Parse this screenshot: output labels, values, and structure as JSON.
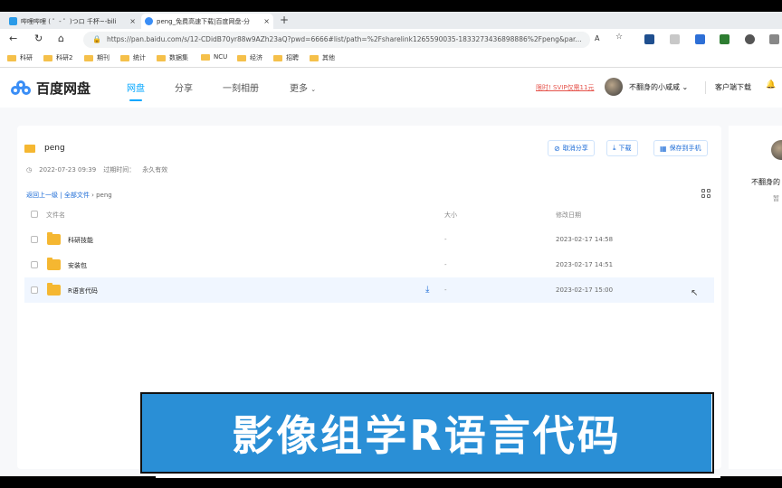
{
  "browser": {
    "tabs": [
      {
        "title": "哔哩哔哩 ( ゜- ゜)つロ 千杯~-bili",
        "color": "#2b9be8"
      },
      {
        "title": "peng_免费高速下载|百度网盘-分",
        "color": "#3a8ef6"
      }
    ],
    "new_tab": "+",
    "close": "×",
    "url": "https://pan.baidu.com/s/12-CDidB70yr88w9AZh23aQ?pwd=6666#list/path=%2Fsharelink1265590035-1833273436898886%2Fpeng&par...",
    "zoom_indicator": "A"
  },
  "bookmarks": [
    "科研",
    "科研2",
    "期刊",
    "统计",
    "数据集",
    "NCU",
    "经济",
    "招聘",
    "其他"
  ],
  "site": {
    "logo": "百度网盘",
    "nav": [
      "网盘",
      "分享",
      "一刻相册",
      "更多"
    ],
    "promo": "限时! SVIP仅需11元",
    "username": "不翻身的小咸咸",
    "client_download": "客户端下载"
  },
  "share": {
    "title": "peng",
    "created": "2022-07-23 09:39",
    "expire_label": "过期时间：",
    "expire_value": "永久有效",
    "buttons": {
      "cancel_share": "取消分享",
      "download": "下载",
      "save_phone": "保存到手机"
    },
    "breadcrumb": {
      "back": "返回上一级",
      "all": "全部文件",
      "current": "peng"
    },
    "columns": {
      "name": "文件名",
      "size": "大小",
      "date": "修改日期"
    },
    "files": [
      {
        "name": "科研技能",
        "size": "-",
        "date": "2023-02-17 14:58"
      },
      {
        "name": "安装包",
        "size": "-",
        "date": "2023-02-17 14:51"
      },
      {
        "name": "R语言代码",
        "size": "-",
        "date": "2023-02-17 15:00"
      }
    ]
  },
  "sidebar_user": {
    "name": "不翻身的",
    "sub": "暂"
  },
  "caption": "影像组学R语言代码"
}
